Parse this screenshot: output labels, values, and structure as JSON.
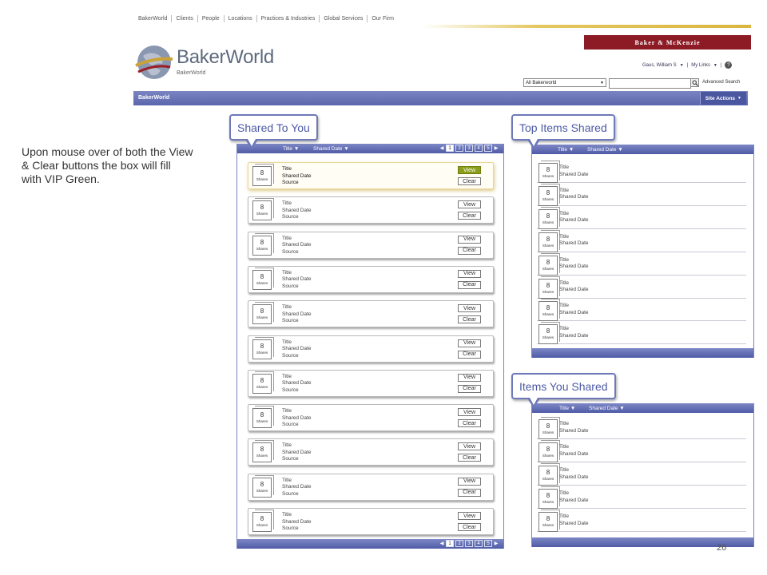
{
  "nav": {
    "items": [
      "BakerWorld",
      "Clients",
      "People",
      "Locations",
      "Practices & Industries",
      "Global Services",
      "Our Firm"
    ]
  },
  "brand": {
    "firm": "Baker & McKenzie",
    "site_title": "BakerWorld",
    "site_subtitle": "BakerWorld"
  },
  "user": {
    "name": "Gaus, William S",
    "mylinks": "My Links"
  },
  "search": {
    "scope": "All Bakerworld",
    "advanced": "Advanced Search"
  },
  "sitebar": {
    "label": "BakerWorld",
    "actions": "Site Actions"
  },
  "annotation": "Upon mouse over of both the View & Clear buttons the box will fill with VIP Green.",
  "shared_to_you": {
    "heading": "Shared To You",
    "sort_title": "Title",
    "sort_date": "Shared Date",
    "pages": [
      "1",
      "2",
      "3",
      "4",
      "5"
    ],
    "active_page": 1,
    "items": [
      {
        "count": "8",
        "unit": "Shares",
        "title": "Title",
        "date": "Shared Date",
        "source": "Source",
        "hover": true
      },
      {
        "count": "8",
        "unit": "Shares",
        "title": "Title",
        "date": "Shared Date",
        "source": "Source"
      },
      {
        "count": "8",
        "unit": "Shares",
        "title": "Title",
        "date": "Shared Date",
        "source": "Source"
      },
      {
        "count": "8",
        "unit": "Shares",
        "title": "Title",
        "date": "Shared Date",
        "source": "Source"
      },
      {
        "count": "8",
        "unit": "Shares",
        "title": "Title",
        "date": "Shared Date",
        "source": "Source"
      },
      {
        "count": "8",
        "unit": "Shares",
        "title": "Title",
        "date": "Shared Date",
        "source": "Source"
      },
      {
        "count": "8",
        "unit": "Shares",
        "title": "Title",
        "date": "Shared Date",
        "source": "Source"
      },
      {
        "count": "8",
        "unit": "Shares",
        "title": "Title",
        "date": "Shared Date",
        "source": "Source"
      },
      {
        "count": "8",
        "unit": "Shares",
        "title": "Title",
        "date": "Shared Date",
        "source": "Source"
      },
      {
        "count": "8",
        "unit": "Shares",
        "title": "Title",
        "date": "Shared Date",
        "source": "Source"
      },
      {
        "count": "8",
        "unit": "Shares",
        "title": "Title",
        "date": "Shared Date",
        "source": "Source"
      }
    ],
    "view_label": "View",
    "clear_label": "Clear"
  },
  "top_items": {
    "heading": "Top Items Shared",
    "sort_title": "Title",
    "sort_date": "Shared Date",
    "items": [
      {
        "count": "8",
        "unit": "Shares",
        "title": "Title",
        "date": "Shared Date"
      },
      {
        "count": "8",
        "unit": "Shares",
        "title": "Title",
        "date": "Shared Date"
      },
      {
        "count": "8",
        "unit": "Shares",
        "title": "Title",
        "date": "Shared Date"
      },
      {
        "count": "8",
        "unit": "Shares",
        "title": "Title",
        "date": "Shared Date"
      },
      {
        "count": "8",
        "unit": "Shares",
        "title": "Title",
        "date": "Shared Date"
      },
      {
        "count": "8",
        "unit": "Shares",
        "title": "Title",
        "date": "Shared Date"
      },
      {
        "count": "8",
        "unit": "Shares",
        "title": "Title",
        "date": "Shared Date"
      },
      {
        "count": "8",
        "unit": "Shares",
        "title": "Title",
        "date": "Shared Date"
      }
    ]
  },
  "items_you_shared": {
    "heading": "Items You Shared",
    "sort_title": "Title",
    "sort_date": "Shared Date",
    "items": [
      {
        "count": "8",
        "unit": "Shares",
        "title": "Title",
        "date": "Shared Date"
      },
      {
        "count": "8",
        "unit": "Shares",
        "title": "Title",
        "date": "Shared Date"
      },
      {
        "count": "8",
        "unit": "Shares",
        "title": "Title",
        "date": "Shared Date"
      },
      {
        "count": "8",
        "unit": "Shares",
        "title": "Title",
        "date": "Shared Date"
      },
      {
        "count": "8",
        "unit": "Shares",
        "title": "Title",
        "date": "Shared Date"
      }
    ]
  },
  "slide_number": "26",
  "colors": {
    "accent": "#5a66ad",
    "brand_red": "#8d1b26",
    "vip_green": "#8a9d1c",
    "gold": "#d9b640"
  },
  "icons": [
    "globe-logo-icon",
    "search-icon",
    "help-icon",
    "dropdown-arrow-icon",
    "pager-prev-icon",
    "pager-next-icon"
  ]
}
